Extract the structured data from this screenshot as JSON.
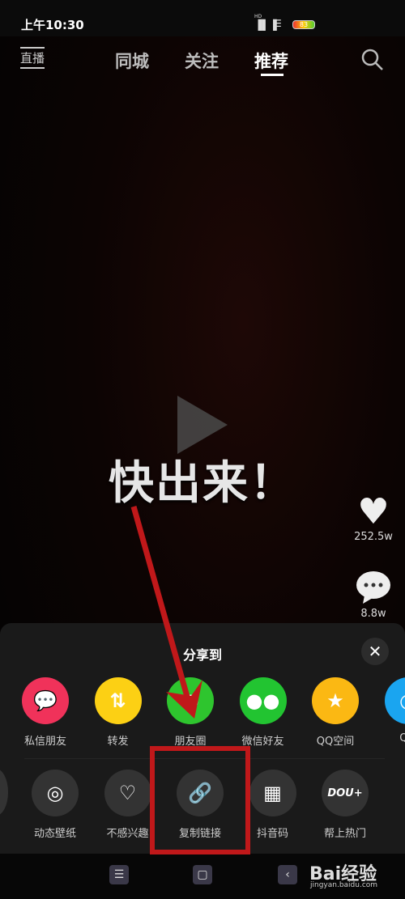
{
  "status": {
    "time": "上午10:30",
    "network": "HD",
    "battery": "83"
  },
  "nav": {
    "live": "直播",
    "tabs": [
      "同城",
      "关注",
      "推荐"
    ],
    "active": "推荐"
  },
  "video": {
    "caption": "快出来！"
  },
  "actions": {
    "likes": "252.5w",
    "comments": "8.8w"
  },
  "share": {
    "title": "分享到",
    "row1": [
      {
        "label": "私信朋友",
        "color": "#f0325a",
        "icon": "message-icon"
      },
      {
        "label": "转发",
        "color": "#fcd014",
        "icon": "repost-icon"
      },
      {
        "label": "朋友圈",
        "color": "#2ec52e",
        "icon": "moments-icon"
      },
      {
        "label": "微信好友",
        "color": "#22c431",
        "icon": "wechat-icon"
      },
      {
        "label": "QQ空间",
        "color": "#fbb813",
        "icon": "qzone-icon"
      },
      {
        "label": "QQ",
        "color": "#1aa5f0",
        "icon": "qq-icon"
      }
    ],
    "row2": [
      {
        "label": "动态壁纸",
        "icon": "wallpaper-icon"
      },
      {
        "label": "不感兴趣",
        "icon": "broken-heart-icon"
      },
      {
        "label": "复制链接",
        "icon": "link-icon"
      },
      {
        "label": "抖音码",
        "icon": "qr-code-icon"
      },
      {
        "label": "帮上热门",
        "icon": "dou-plus-icon",
        "text": "DOU+"
      }
    ]
  },
  "annotation_color": "#c0181a",
  "watermark": {
    "brand": "Bai经验",
    "url": "jingyan.baidu.com"
  }
}
